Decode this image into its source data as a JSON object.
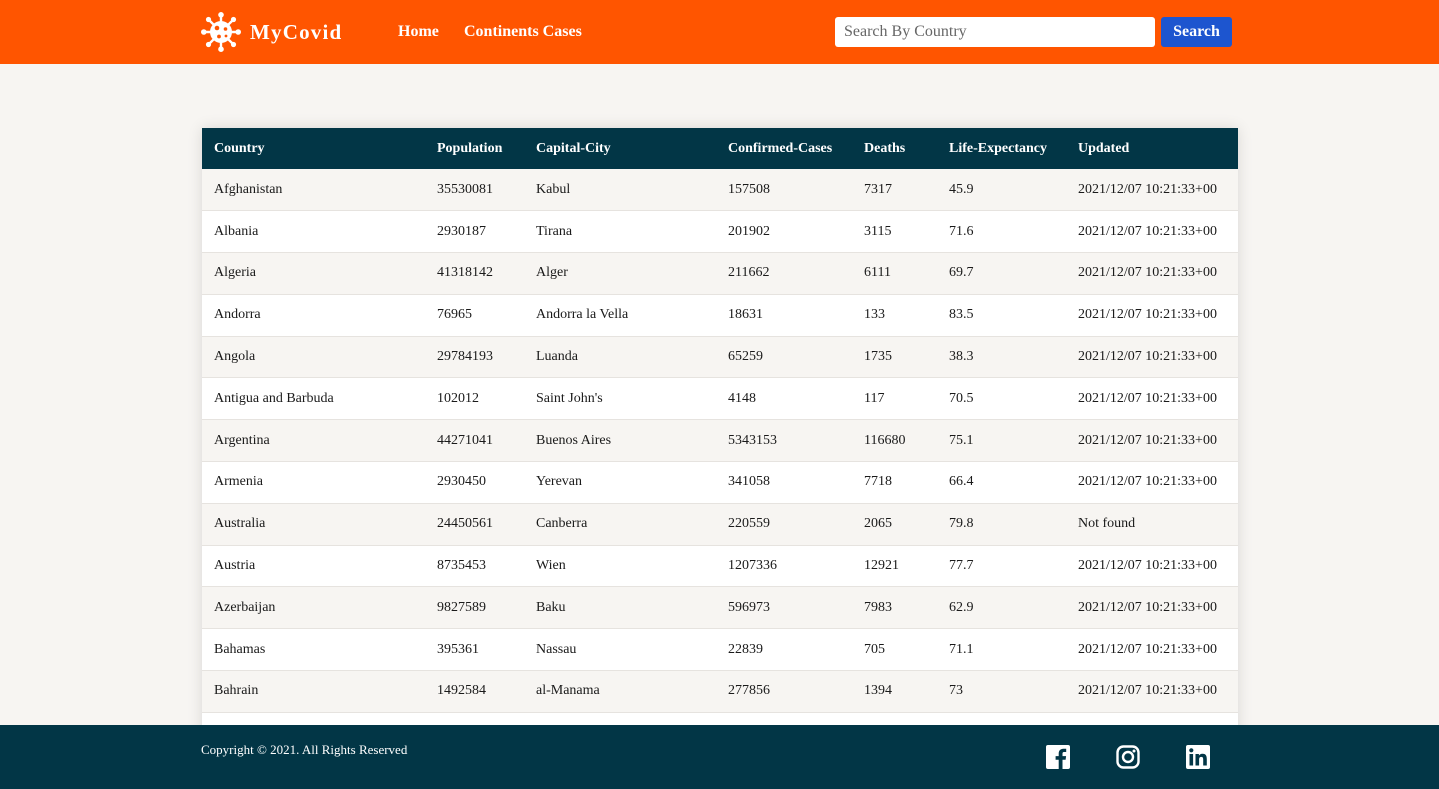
{
  "brand": {
    "name": "MyCovid",
    "logo_icon": "virus-icon"
  },
  "nav": {
    "home": "Home",
    "continents": "Continents Cases"
  },
  "search": {
    "placeholder": "Search By Country",
    "value": "",
    "button": "Search"
  },
  "colors": {
    "navbar": "#ff5500",
    "header_row": "#023646",
    "footer": "#023646",
    "search_button": "#1d55cf",
    "page_bg": "#f7f5f2"
  },
  "table": {
    "columns": [
      "Country",
      "Population",
      "Capital-City",
      "Confirmed-Cases",
      "Deaths",
      "Life-Expectancy",
      "Updated"
    ],
    "rows": [
      [
        "Afghanistan",
        "35530081",
        "Kabul",
        "157508",
        "7317",
        "45.9",
        "2021/12/07 10:21:33+00"
      ],
      [
        "Albania",
        "2930187",
        "Tirana",
        "201902",
        "3115",
        "71.6",
        "2021/12/07 10:21:33+00"
      ],
      [
        "Algeria",
        "41318142",
        "Alger",
        "211662",
        "6111",
        "69.7",
        "2021/12/07 10:21:33+00"
      ],
      [
        "Andorra",
        "76965",
        "Andorra la Vella",
        "18631",
        "133",
        "83.5",
        "2021/12/07 10:21:33+00"
      ],
      [
        "Angola",
        "29784193",
        "Luanda",
        "65259",
        "1735",
        "38.3",
        "2021/12/07 10:21:33+00"
      ],
      [
        "Antigua and Barbuda",
        "102012",
        "Saint John's",
        "4148",
        "117",
        "70.5",
        "2021/12/07 10:21:33+00"
      ],
      [
        "Argentina",
        "44271041",
        "Buenos Aires",
        "5343153",
        "116680",
        "75.1",
        "2021/12/07 10:21:33+00"
      ],
      [
        "Armenia",
        "2930450",
        "Yerevan",
        "341058",
        "7718",
        "66.4",
        "2021/12/07 10:21:33+00"
      ],
      [
        "Australia",
        "24450561",
        "Canberra",
        "220559",
        "2065",
        "79.8",
        "Not found"
      ],
      [
        "Austria",
        "8735453",
        "Wien",
        "1207336",
        "12921",
        "77.7",
        "2021/12/07 10:21:33+00"
      ],
      [
        "Azerbaijan",
        "9827589",
        "Baku",
        "596973",
        "7983",
        "62.9",
        "2021/12/07 10:21:33+00"
      ],
      [
        "Bahamas",
        "395361",
        "Nassau",
        "22839",
        "705",
        "71.1",
        "2021/12/07 10:21:33+00"
      ],
      [
        "Bahrain",
        "1492584",
        "al-Manama",
        "277856",
        "1394",
        "73",
        "2021/12/07 10:21:33+00"
      ],
      [
        "",
        "",
        "",
        "",
        "",
        "",
        ""
      ]
    ]
  },
  "footer": {
    "copyright": "Copyright © 2021. All Rights Reserved",
    "social_icons": [
      "facebook-icon",
      "instagram-icon",
      "linkedin-icon"
    ]
  }
}
